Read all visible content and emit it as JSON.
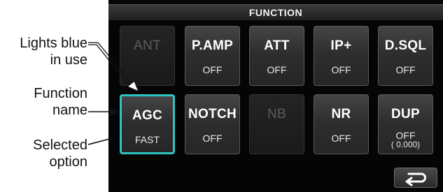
{
  "annotations": {
    "lights_blue_line1": "Lights blue",
    "lights_blue_line2": "in use",
    "function_name_line1": "Function",
    "function_name_line2": "name",
    "selected_option_line1": "Selected",
    "selected_option_line2": "option"
  },
  "screen": {
    "title": "FUNCTION",
    "keys": [
      {
        "name": "ANT",
        "option": ""
      },
      {
        "name": "P.AMP",
        "option": "OFF"
      },
      {
        "name": "ATT",
        "option": "OFF"
      },
      {
        "name": "IP+",
        "option": "OFF"
      },
      {
        "name": "D.SQL",
        "option": "OFF"
      },
      {
        "name": "AGC",
        "option": "FAST"
      },
      {
        "name": "NOTCH",
        "option": "OFF"
      },
      {
        "name": "NB",
        "option": ""
      },
      {
        "name": "NR",
        "option": "OFF"
      },
      {
        "name": "DUP",
        "option": "OFF",
        "sub": "(   0.000)"
      }
    ]
  },
  "colors": {
    "selected_border": "#2fc4c4",
    "screen_background": "#050505",
    "key_text": "#ffffff",
    "dimmed_key_text": "#5c5c5c"
  },
  "icons": [
    "return-arrow-icon"
  ]
}
